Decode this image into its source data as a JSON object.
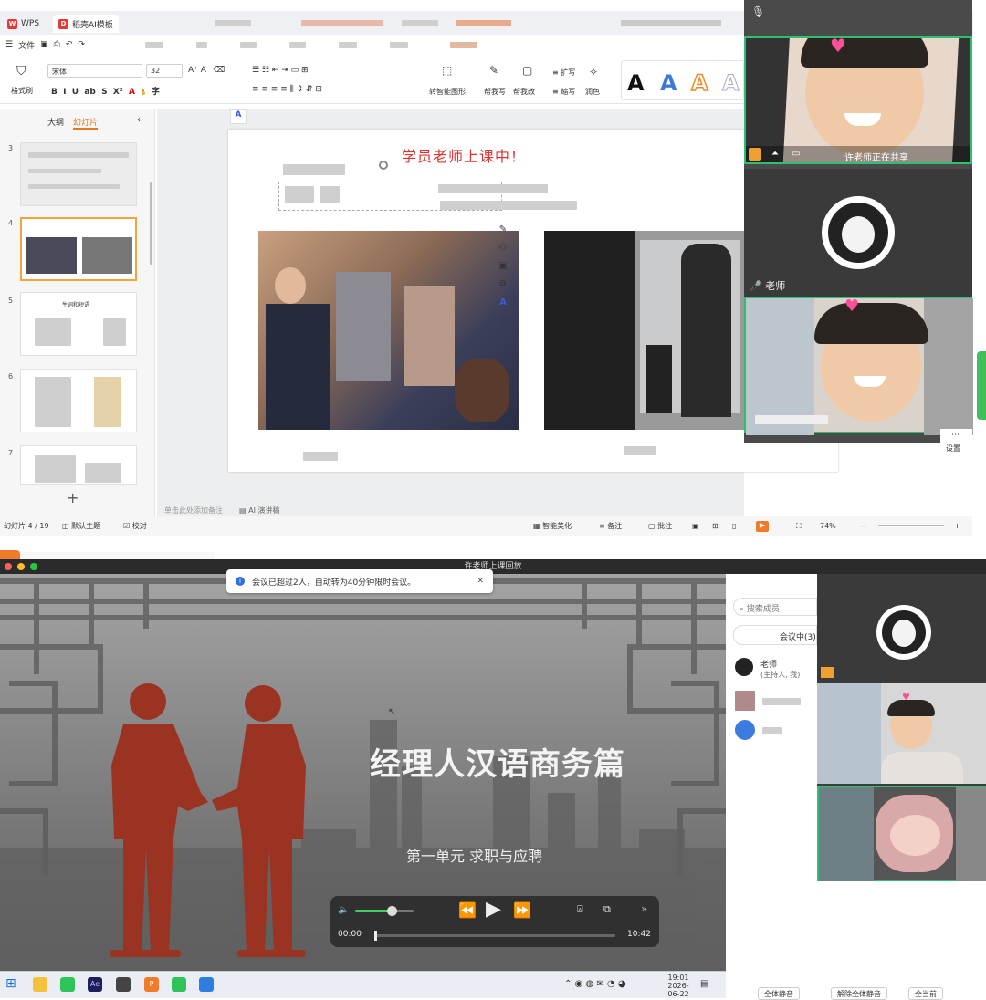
{
  "wps": {
    "tabs": [
      {
        "label": "WPS"
      },
      {
        "label": "稻壳AI模板"
      }
    ],
    "menu": {
      "file": "文件"
    },
    "ribbon": {
      "format_painter": "格式刷",
      "font_name": "宋体",
      "font_size": "32",
      "convert_smart": "转智能图形",
      "help_write": "帮我写",
      "help_edit": "帮我改",
      "expand": "扩写",
      "shorten": "缩写",
      "polish": "润色"
    },
    "left_panel": {
      "tab_outline": "大纲",
      "tab_slides": "幻灯片",
      "slide_numbers": [
        "3",
        "4",
        "5",
        "6",
        "7"
      ],
      "thumb5_title": "生词和短语"
    },
    "slide": {
      "title": "学员老师上课中！"
    },
    "statusbar": {
      "slide_count": "幻灯片 4 / 19",
      "theme": "默认主题",
      "proofread": "校对",
      "notes_hint": "单击此处添加备注",
      "ai_speech": "AI 演讲稿",
      "smart_beautify": "智能美化",
      "notes": "备注",
      "comments": "批注",
      "zoom": "74%"
    }
  },
  "meeting_top": {
    "sharing_text": "许老师正在共享",
    "teacher_label": "老师",
    "settings": "设置"
  },
  "player": {
    "window_title": "许老师上课回放",
    "notice": "会议已超过2人，自动转为40分钟限时会议。",
    "video_title": "经理人汉语商务篇",
    "video_subtitle": "第一单元  求职与应聘",
    "time_current": "00:00",
    "time_total": "10:42",
    "volume_level": 0.62,
    "playback_progress": 0.0
  },
  "members": {
    "search_placeholder": "搜索成员",
    "in_meeting": "会议中(3)",
    "teacher_name": "老师",
    "teacher_role": "(主持人, 我)"
  },
  "taskbar": {
    "time": "19:01",
    "date": "2026-06-22"
  },
  "bottom_buttons": [
    "全体静音",
    "解除全体静音",
    "全当前"
  ]
}
